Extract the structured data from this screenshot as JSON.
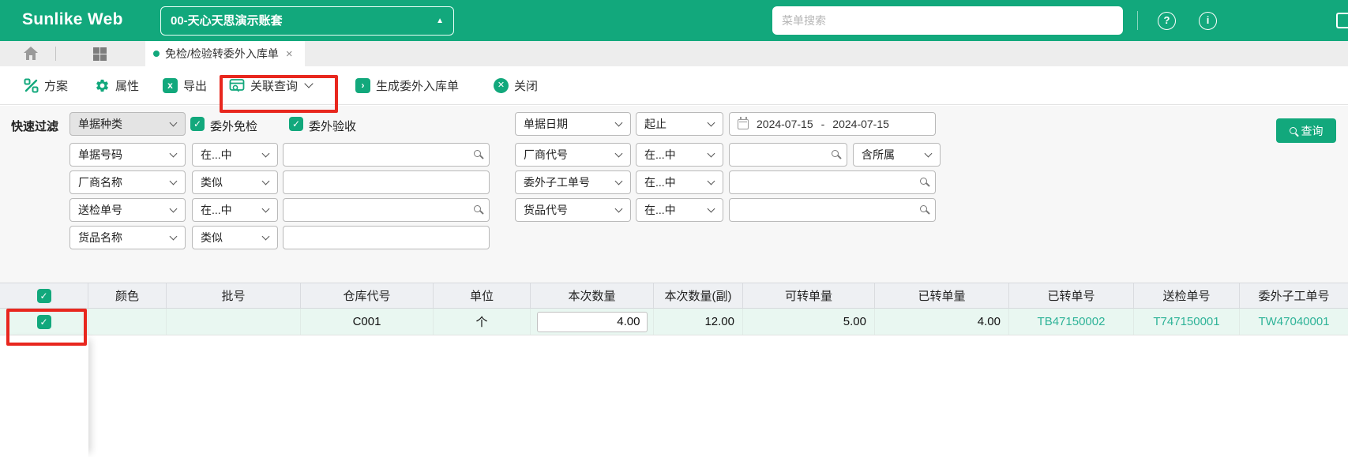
{
  "header": {
    "logo": "Sunlike Web",
    "account": "00-天心天思演示账套",
    "search_placeholder": "菜单搜索"
  },
  "tabbar": {
    "tab_label": "免检/检验转委外入库单"
  },
  "toolbar": {
    "items": [
      {
        "label": "方案",
        "icon": "plan-icon"
      },
      {
        "label": "属性",
        "icon": "gear-icon"
      },
      {
        "label": "导出",
        "icon": "excel-export-icon"
      },
      {
        "label": "关联查询",
        "icon": "linked-query-icon"
      },
      {
        "label": "生成委外入库单",
        "icon": "generate-icon"
      },
      {
        "label": "关闭",
        "icon": "close-circle-icon"
      }
    ]
  },
  "filters": {
    "label": "快速过滤",
    "row1": {
      "kind_select": "单据种类",
      "cb1": "委外免检",
      "cb2": "委外验收",
      "date_field": "单据日期",
      "range_mode": "起止",
      "date_from": "2024-07-15",
      "date_sep": "-",
      "date_to": "2024-07-15",
      "query_button": "查询"
    },
    "row2": {
      "field": "单据号码",
      "op": "在...中",
      "value": "",
      "field2": "厂商代号",
      "op2": "在...中",
      "value2": "",
      "scope_select": "含所属"
    },
    "row3": {
      "field": "厂商名称",
      "op": "类似",
      "value": "",
      "field2": "委外子工单号",
      "op2": "在...中",
      "value2": ""
    },
    "row4": {
      "field": "送检单号",
      "op": "在...中",
      "value": "",
      "field2": "货品代号",
      "op2": "在...中",
      "value2": ""
    },
    "row5": {
      "field": "货品名称",
      "op": "类似",
      "value": ""
    }
  },
  "table": {
    "columns": [
      "颜色",
      "批号",
      "仓库代号",
      "单位",
      "本次数量",
      "本次数量(副)",
      "可转单量",
      "已转单量",
      "已转单号",
      "送检单号",
      "委外子工单号"
    ],
    "row": {
      "color": "",
      "batch": "",
      "warehouse": "C001",
      "unit": "个",
      "qty_input": "4.00",
      "qty_secondary": "12.00",
      "transferable_qty": "5.00",
      "transferred_qty": "4.00",
      "transfer_doc_no": "TB47150002",
      "inspection_doc_no": "T747150001",
      "subwork_order_no": "TW47040001"
    }
  },
  "icons": {
    "check": "✓",
    "tab_close": "×",
    "caret_up": "▲",
    "help": "?",
    "info": "i",
    "excel": "x",
    "generate": "›",
    "close": "✕"
  },
  "colors": {
    "brand_green": "#12a87c",
    "link_teal": "#2eb398",
    "annotation_red": "#e8271e",
    "row_highlight": "#e9f7f1"
  }
}
